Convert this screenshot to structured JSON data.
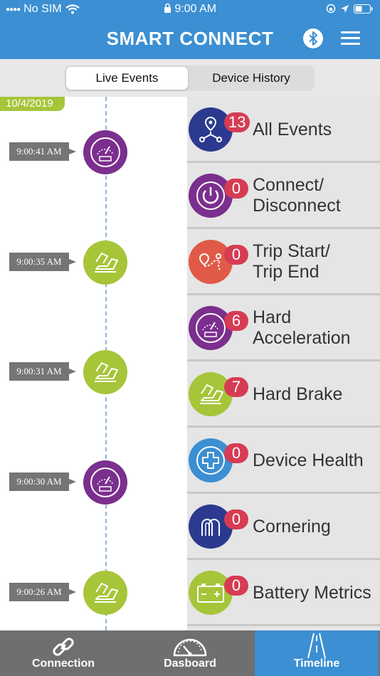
{
  "status_bar": {
    "carrier": "No SIM",
    "time": "9:00 AM"
  },
  "header": {
    "title": "SMART CONNECT",
    "bluetooth_icon": "bluetooth-icon",
    "menu_icon": "hamburger-menu-icon"
  },
  "segments": {
    "active": "Live Events",
    "inactive": "Device History"
  },
  "timeline": {
    "date": "10/4/2019",
    "events": [
      {
        "time": "9:00:41 AM",
        "icon": "speedometer-icon",
        "color": "#7b2f8e"
      },
      {
        "time": "9:00:35 AM",
        "icon": "brake-pedal-icon",
        "color": "#a6c539"
      },
      {
        "time": "9:00:31 AM",
        "icon": "brake-pedal-icon",
        "color": "#a6c539"
      },
      {
        "time": "9:00:30 AM",
        "icon": "speedometer-icon",
        "color": "#7b2f8e"
      },
      {
        "time": "9:00:26 AM",
        "icon": "brake-pedal-icon",
        "color": "#a6c539"
      }
    ]
  },
  "event_types": [
    {
      "label": "All Events",
      "count": "13",
      "icon": "route-nodes-icon",
      "color": "#2b3a8f"
    },
    {
      "label": "Connect/\nDisconnect",
      "count": "0",
      "icon": "power-icon",
      "color": "#7b2f8e"
    },
    {
      "label": "Trip Start/\nTrip End",
      "count": "0",
      "icon": "trip-route-icon",
      "color": "#e05a47"
    },
    {
      "label": "Hard\nAcceleration",
      "count": "6",
      "icon": "speedometer-icon",
      "color": "#7b2f8e"
    },
    {
      "label": "Hard Brake",
      "count": "7",
      "icon": "brake-pedal-icon",
      "color": "#a6c539"
    },
    {
      "label": "Device Health",
      "count": "0",
      "icon": "health-cross-icon",
      "color": "#3b8fd2"
    },
    {
      "label": "Cornering",
      "count": "0",
      "icon": "cornering-icon",
      "color": "#2b3a8f"
    },
    {
      "label": "Battery Metrics",
      "count": "0",
      "icon": "battery-icon",
      "color": "#a6c539"
    }
  ],
  "tabs": [
    {
      "label": "Connection",
      "icon": "link-icon"
    },
    {
      "label": "Dasboard",
      "icon": "gauge-icon"
    },
    {
      "label": "Timeline",
      "icon": "road-icon",
      "active": true
    }
  ],
  "colors": {
    "header": "#3b8fd2",
    "badge": "#d63c54",
    "date_tag": "#a6c539",
    "tabbar": "#6f6f6f"
  }
}
